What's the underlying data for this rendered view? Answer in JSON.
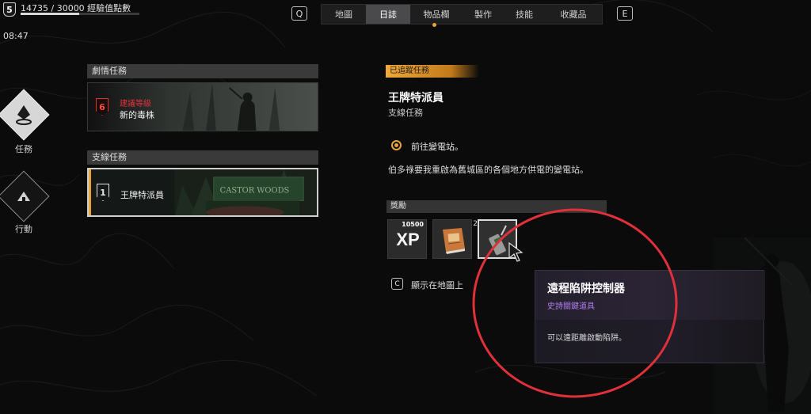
{
  "hud": {
    "level": "5",
    "xp_text": "14735 / 30000 經驗值點數",
    "xp_progress": 0.49,
    "time": "08:47"
  },
  "nav": {
    "left_key": "Q",
    "right_key": "E",
    "tabs": [
      {
        "label": "地圖",
        "active": false
      },
      {
        "label": "日誌",
        "active": true
      },
      {
        "label": "物品欄",
        "active": false
      },
      {
        "label": "製作",
        "active": false
      },
      {
        "label": "技能",
        "active": false
      },
      {
        "label": "收藏品",
        "active": false
      }
    ]
  },
  "sidebar": {
    "items": [
      {
        "label": "任務",
        "icon": "quest-marker-icon",
        "active": true
      },
      {
        "label": "行動",
        "icon": "camp-icon",
        "active": false
      }
    ]
  },
  "story": {
    "header": "劇情任務",
    "quest": {
      "level": "6",
      "requirement": "建議等級",
      "title": "新的毒株"
    }
  },
  "side": {
    "header": "支線任務",
    "quest": {
      "level": "1",
      "title": "王牌特派員",
      "sign_text": "CASTOR WOODS"
    }
  },
  "detail": {
    "tracked_label": "已追蹤任務",
    "title": "王牌特派員",
    "type": "支線任務",
    "objective": "前往變電站。",
    "description": "伯多祿要我重啟為舊城區的各個地方供電的變電站。",
    "rewards_header": "獎勵",
    "rewards": [
      {
        "kind": "xp",
        "amount": "10500",
        "label": "XP"
      },
      {
        "kind": "item",
        "icon": "manual-icon",
        "count": "2"
      },
      {
        "kind": "item",
        "icon": "remote-trap-controller-icon",
        "selected": true
      }
    ],
    "map_key": "C",
    "map_label": "顯示在地圖上"
  },
  "tooltip": {
    "name": "遠程陷阱控制器",
    "rarity": "史詩關鍵道具",
    "description": "可以遠距離啟動陷阱。",
    "rarity_color": "#b07cf0"
  },
  "colors": {
    "accent": "#e8a33c",
    "danger": "#e0323a",
    "annotation": "#e0303a"
  }
}
